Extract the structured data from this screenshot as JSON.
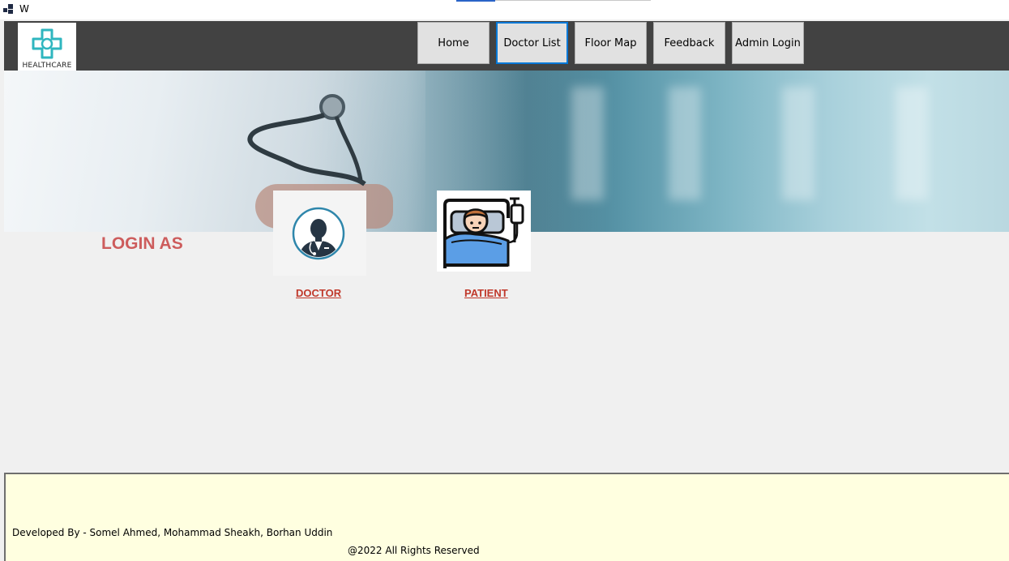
{
  "window": {
    "title": "W"
  },
  "brand": {
    "logo_text": "HEALTHCARE",
    "accent_color": "#2fb6bf"
  },
  "nav": {
    "items": [
      {
        "label": "Home"
      },
      {
        "label": "Doctor List"
      },
      {
        "label": "Floor Map"
      },
      {
        "label": "Feedback"
      },
      {
        "label": "Admin Login"
      }
    ],
    "active": "Doctor List",
    "bar_color": "#424242"
  },
  "main": {
    "heading": "LOGIN AS",
    "heading_color": "#cd5c5c",
    "options": [
      {
        "label": "DOCTOR",
        "icon": "doctor-avatar-icon"
      },
      {
        "label": "PATIENT",
        "icon": "patient-in-bed-icon"
      }
    ],
    "link_color": "#c0392b"
  },
  "footer": {
    "developed_by": "Developed By - Somel Ahmed, Mohammad Sheakh, Borhan Uddin",
    "rights": "@2022 All Rights Reserved",
    "background": "#ffffe0"
  }
}
